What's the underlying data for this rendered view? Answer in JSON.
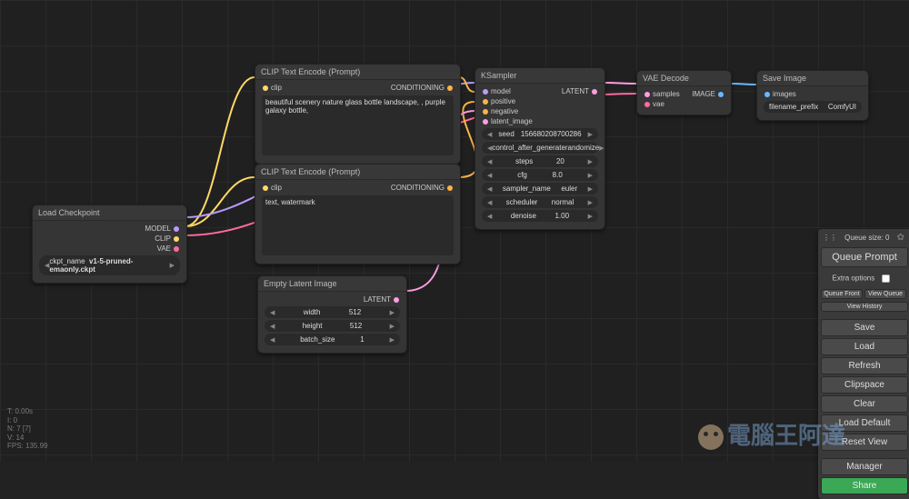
{
  "nodes": {
    "loadckpt": {
      "title": "Load Checkpoint",
      "out": [
        "MODEL",
        "CLIP",
        "VAE"
      ],
      "widgets": [
        {
          "label": "ckpt_name",
          "value": "v1-5-pruned-emaonly.ckpt"
        }
      ]
    },
    "clip_pos": {
      "title": "CLIP Text Encode (Prompt)",
      "in": [
        "clip"
      ],
      "out": [
        "CONDITIONING"
      ],
      "text": "beautiful scenery nature glass bottle landscape, , purple galaxy bottle,"
    },
    "clip_neg": {
      "title": "CLIP Text Encode (Prompt)",
      "in": [
        "clip"
      ],
      "out": [
        "CONDITIONING"
      ],
      "text": "text, watermark"
    },
    "latent": {
      "title": "Empty Latent Image",
      "out": [
        "LATENT"
      ],
      "widgets": [
        {
          "label": "width",
          "value": "512"
        },
        {
          "label": "height",
          "value": "512"
        },
        {
          "label": "batch_size",
          "value": "1"
        }
      ]
    },
    "ksampler": {
      "title": "KSampler",
      "in": [
        "model",
        "positive",
        "negative",
        "latent_image"
      ],
      "out": [
        "LATENT"
      ],
      "widgets": [
        {
          "label": "seed",
          "value": "156680208700286"
        },
        {
          "label": "control_after_generate",
          "value": "randomize"
        },
        {
          "label": "steps",
          "value": "20"
        },
        {
          "label": "cfg",
          "value": "8.0"
        },
        {
          "label": "sampler_name",
          "value": "euler"
        },
        {
          "label": "scheduler",
          "value": "normal"
        },
        {
          "label": "denoise",
          "value": "1.00"
        }
      ]
    },
    "vae": {
      "title": "VAE Decode",
      "in": [
        "samples",
        "vae"
      ],
      "out": [
        "IMAGE"
      ]
    },
    "save": {
      "title": "Save Image",
      "in": [
        "images"
      ],
      "widgets": [
        {
          "label": "filename_prefix",
          "value": "ComfyUI"
        }
      ]
    }
  },
  "panel": {
    "queue": "Queue size: 0",
    "extra": "Extra options",
    "buttons": {
      "queue_prompt": "Queue Prompt",
      "queue_front": "Queue Front",
      "view_queue": "View Queue",
      "view_history": "View History",
      "save": "Save",
      "load": "Load",
      "refresh": "Refresh",
      "clipspace": "Clipspace",
      "clear": "Clear",
      "load_default": "Load Default",
      "reset_view": "Reset View",
      "manager": "Manager",
      "share": "Share"
    }
  },
  "stats": [
    "T: 0.00s",
    "I: 0",
    "N: 7 [7]",
    "V: 14",
    "FPS: 135.99"
  ],
  "watermark": "電腦王阿達"
}
